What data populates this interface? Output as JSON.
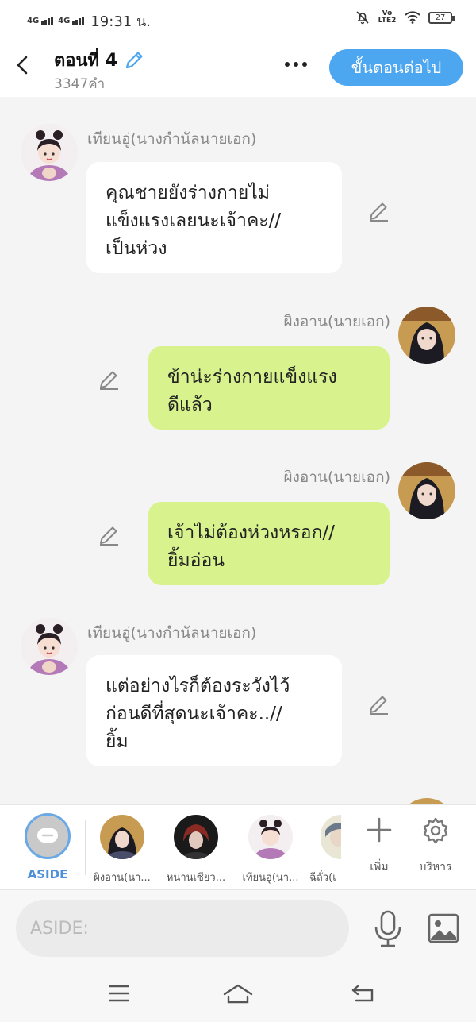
{
  "status_bar": {
    "network_1": "4G",
    "network_2": "4G",
    "time": "19:31 น.",
    "volte": "Vo LTE2",
    "battery": "27"
  },
  "header": {
    "title": "ตอนที่ 4",
    "word_count": "3347คำ",
    "next_button": "ขั้นตอนต่อไป"
  },
  "messages": [
    {
      "speaker": "เทียนอู่(นางกำนัลนายเอก)",
      "side": "left",
      "lines": [
        "คุณชายยังร่างกายไม่",
        "แข็งแรงเลยนะเจ้าคะ//",
        "เป็นห่วง"
      ]
    },
    {
      "speaker": "ผิงอาน(นายเอก)",
      "side": "right",
      "lines": [
        "ข้าน่ะร่างกายแข็งแรง",
        "ดีแล้ว"
      ]
    },
    {
      "speaker": "ผิงอาน(นายเอก)",
      "side": "right",
      "lines": [
        "เจ้าไม่ต้องห่วงหรอก//",
        "ยิ้มอ่อน"
      ]
    },
    {
      "speaker": "เทียนอู่(นางกำนัลนายเอก)",
      "side": "left",
      "lines": [
        "แต่อย่างไรก็ต้องระวังไว้",
        "ก่อนดีที่สุดนะเจ้าคะ..//",
        "ยิ้ม"
      ]
    }
  ],
  "characters": {
    "aside_label": "ASIDE",
    "list": [
      {
        "label": "ผิงอาน(นา..."
      },
      {
        "label": "หนานเซียว..."
      },
      {
        "label": "เทียนอู่(นา..."
      },
      {
        "label": "ฉีลั่ว(เ"
      }
    ],
    "add_label": "เพิ่ม",
    "manage_label": "บริหาร"
  },
  "input": {
    "placeholder": "ASIDE:"
  },
  "colors": {
    "accent": "#4da6f0",
    "own_bubble": "#d8f38e",
    "other_bubble": "#ffffff"
  }
}
